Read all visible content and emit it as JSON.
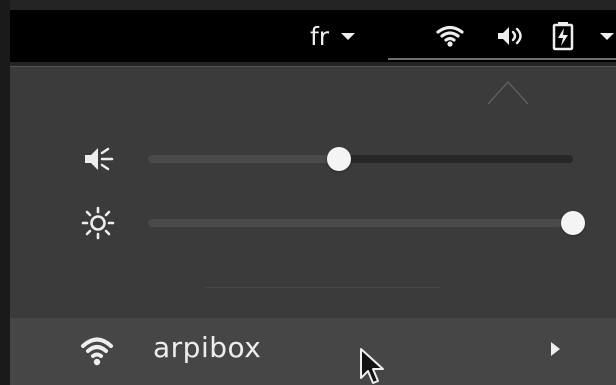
{
  "topbar": {
    "language": "fr",
    "icons": {
      "wifi": "wifi-icon",
      "volume": "volume-icon",
      "battery": "battery-icon",
      "dropdown": "chevron-down-icon"
    }
  },
  "sliders": {
    "volume": {
      "icon": "volume-low-icon",
      "level": 0.45
    },
    "brightness": {
      "icon": "brightness-icon",
      "level": 1.0
    }
  },
  "network": {
    "name": "arpibox",
    "icon": "wifi-icon",
    "submenu_icon": "chevron-right-icon"
  },
  "colors": {
    "topbar": "#000000",
    "panel": "#3b3b3b",
    "track": "#272727",
    "track_fill": "#4a4a4a",
    "knob": "#f4f4f4",
    "network_row": "#464646",
    "text": "#eeeeee"
  }
}
